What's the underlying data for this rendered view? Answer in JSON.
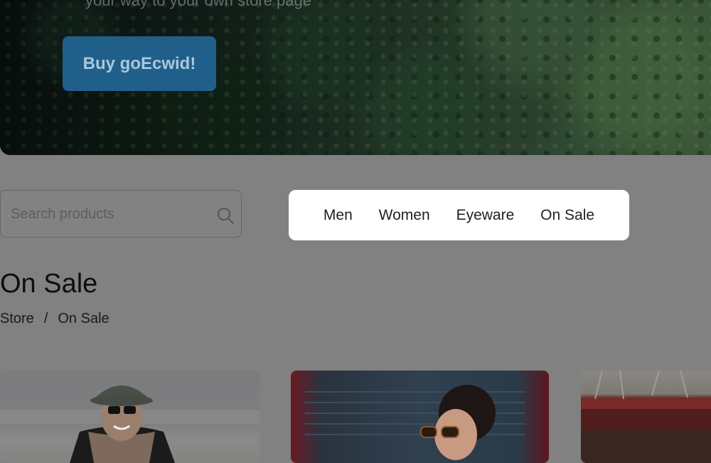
{
  "hero": {
    "tagline": "your way to your own store page",
    "buy_button": "Buy goEcwid!"
  },
  "search": {
    "placeholder": "Search products",
    "icon": "search-icon"
  },
  "categories": [
    "Men",
    "Women",
    "Eyeware",
    "On Sale"
  ],
  "page": {
    "title": "On Sale",
    "breadcrumb": [
      "Store",
      "On Sale"
    ],
    "breadcrumb_separator": "/"
  },
  "products": [
    {
      "image": "man-with-hat-sunglasses-beach"
    },
    {
      "image": "woman-sunglasses-in-truck"
    },
    {
      "image": "red-truck-under-trees"
    }
  ],
  "colors": {
    "overlay": "#818181",
    "button": "#1f5f8a",
    "nav_bg": "#ffffff"
  }
}
